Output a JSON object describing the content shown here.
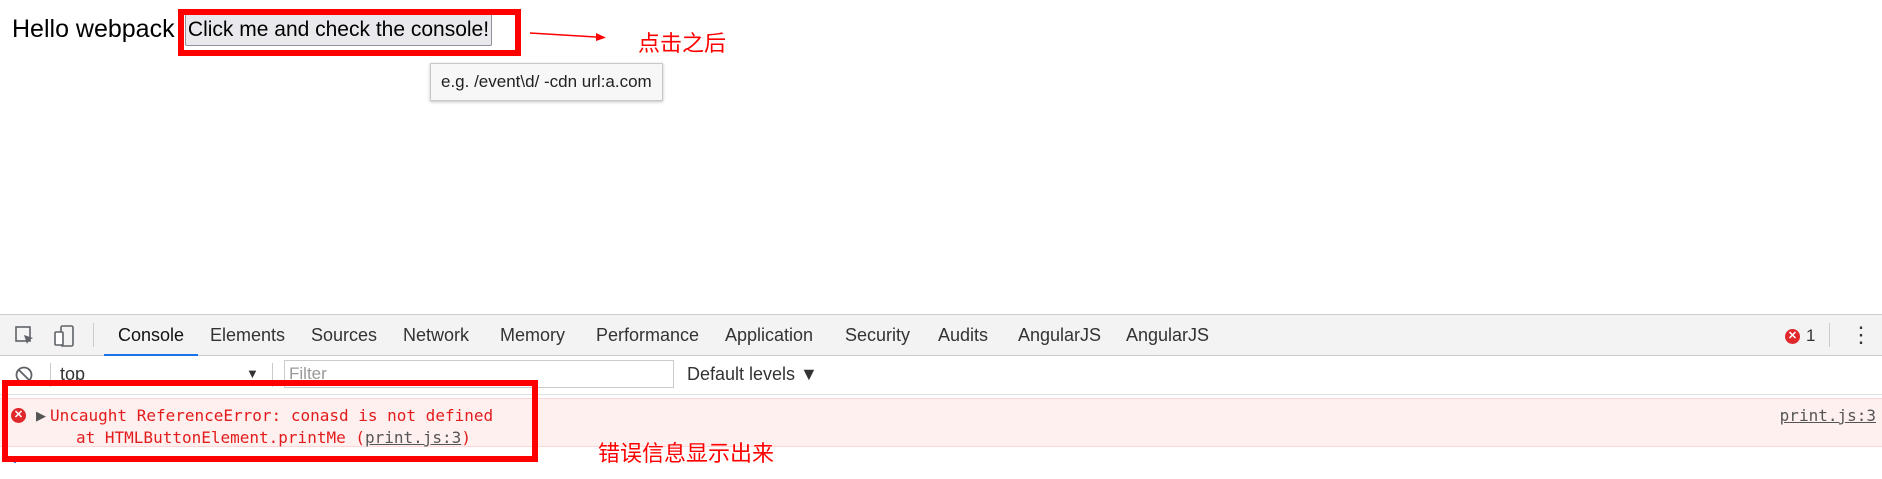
{
  "page": {
    "heading": "Hello webpack",
    "button_label": "Click me and check the console!"
  },
  "annotations": {
    "after_click": "点击之后",
    "error_shown": "错误信息显示出来"
  },
  "devtools": {
    "tabs": [
      "Console",
      "Elements",
      "Sources",
      "Network",
      "Memory",
      "Performance",
      "Application",
      "Security",
      "Audits",
      "AngularJS",
      "AngularJS"
    ],
    "active_tab": "Console",
    "error_count": "1",
    "context": "top",
    "filter_placeholder": "Filter",
    "levels_label": "Default levels ▼",
    "filter_tooltip": "e.g. /event\\d/ -cdn url:a.com",
    "error": {
      "line1": "Uncaught ReferenceError: conasd is not defined",
      "line2_prefix": "at HTMLButtonElement.printMe (",
      "line2_link": "print.js:3",
      "line2_suffix": ")",
      "source": "print.js:3"
    }
  },
  "colors": {
    "annotation": "#ff0000",
    "error_text": "#e21c1c",
    "error_bg": "#fff0f0",
    "active_tab_underline": "#1a73e8"
  }
}
